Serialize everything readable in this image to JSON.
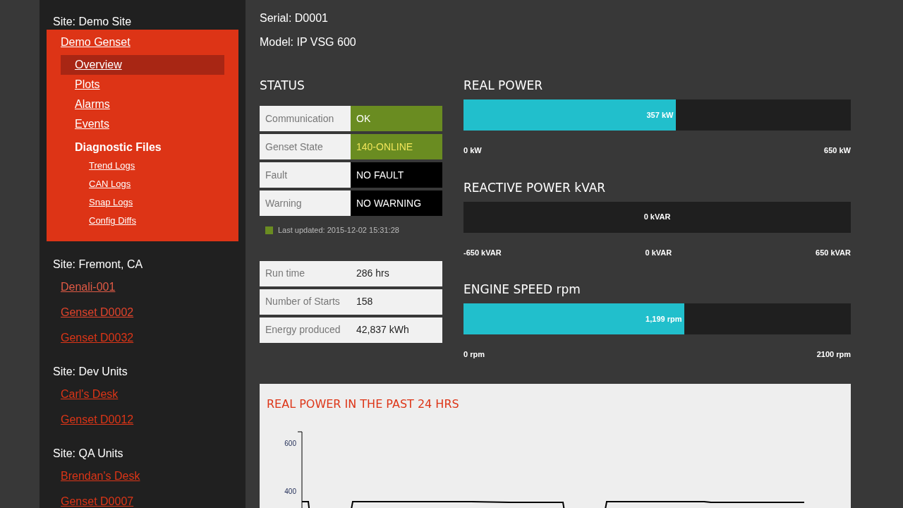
{
  "sidebar": {
    "sites": [
      {
        "title": "Site: Demo Site",
        "units": [
          {
            "label": "Demo Genset",
            "expanded": true,
            "color": "#ffffff",
            "menu": [
              {
                "label": "Overview",
                "kind": "link",
                "selected": true
              },
              {
                "label": "Plots",
                "kind": "link",
                "selected": false
              },
              {
                "label": "Alarms",
                "kind": "link",
                "selected": false
              },
              {
                "label": "Events",
                "kind": "link",
                "selected": false
              },
              {
                "label": "Diagnostic Files",
                "kind": "heading",
                "selected": false,
                "children": [
                  {
                    "label": "Trend Logs"
                  },
                  {
                    "label": "CAN Logs"
                  },
                  {
                    "label": "Snap Logs"
                  },
                  {
                    "label": "Config Diffs"
                  }
                ]
              }
            ]
          }
        ]
      },
      {
        "title": "Site: Fremont, CA",
        "units": [
          {
            "label": "Denali-001",
            "expanded": false,
            "color": "#e05a45"
          },
          {
            "label": "Genset D0002",
            "expanded": false,
            "color": "#e0432b"
          },
          {
            "label": "Genset D0032",
            "expanded": false,
            "color": "#dc3517"
          }
        ]
      },
      {
        "title": "Site: Dev Units",
        "units": [
          {
            "label": "Carl's Desk",
            "expanded": false,
            "color": "#dc3517"
          },
          {
            "label": "Genset D0012",
            "expanded": false,
            "color": "#dc3517"
          }
        ]
      },
      {
        "title": "Site: QA Units",
        "units": [
          {
            "label": "Brendan's Desk",
            "expanded": false,
            "color": "#dc3517"
          },
          {
            "label": "Genset D0007",
            "expanded": false,
            "color": "#dc3517"
          }
        ]
      }
    ]
  },
  "header": {
    "serial": "Serial: D0001",
    "model": "Model: IP VSG 600"
  },
  "status": {
    "title": "STATUS",
    "rows": [
      {
        "label": "Communication",
        "value": "OK",
        "color": "#6a8c21",
        "highlighted": false
      },
      {
        "label": "Genset State",
        "value": "140-ONLINE",
        "color": "#6a8c21",
        "highlighted": true
      },
      {
        "label": "Fault",
        "value": "NO FAULT",
        "color": "#000000",
        "highlighted": false
      },
      {
        "label": "Warning",
        "value": "NO WARNING",
        "color": "#000000",
        "highlighted": false
      }
    ],
    "legend": {
      "color": "#6a8c21",
      "text": "Last updated: 2015-12-02 15:31:28"
    }
  },
  "stats": [
    {
      "label": "Run time",
      "value": "286 hrs"
    },
    {
      "label": "Number of Starts",
      "value": "158"
    },
    {
      "label": "Energy produced",
      "value": "42,837 kWh"
    }
  ],
  "gauges": [
    {
      "title": "REAL POWER",
      "kind": "fill",
      "level": 0.549,
      "reading": "357 kW",
      "scale": [
        "0 kW",
        "650 kW"
      ]
    },
    {
      "title": "REACTIVE POWER kVAR",
      "kind": "center",
      "reading": "0 kVAR",
      "scale": [
        "-650 kVAR",
        "0 kVAR",
        "650 kVAR"
      ]
    },
    {
      "title": "ENGINE SPEED rpm",
      "kind": "fill",
      "level": 0.571,
      "reading": "1,199 rpm",
      "scale": [
        "0 rpm",
        "2100 rpm"
      ]
    }
  ],
  "history": {
    "title": "REAL POWER IN THE PAST 24 HRS",
    "y_labels": [
      "600",
      "400"
    ]
  }
}
